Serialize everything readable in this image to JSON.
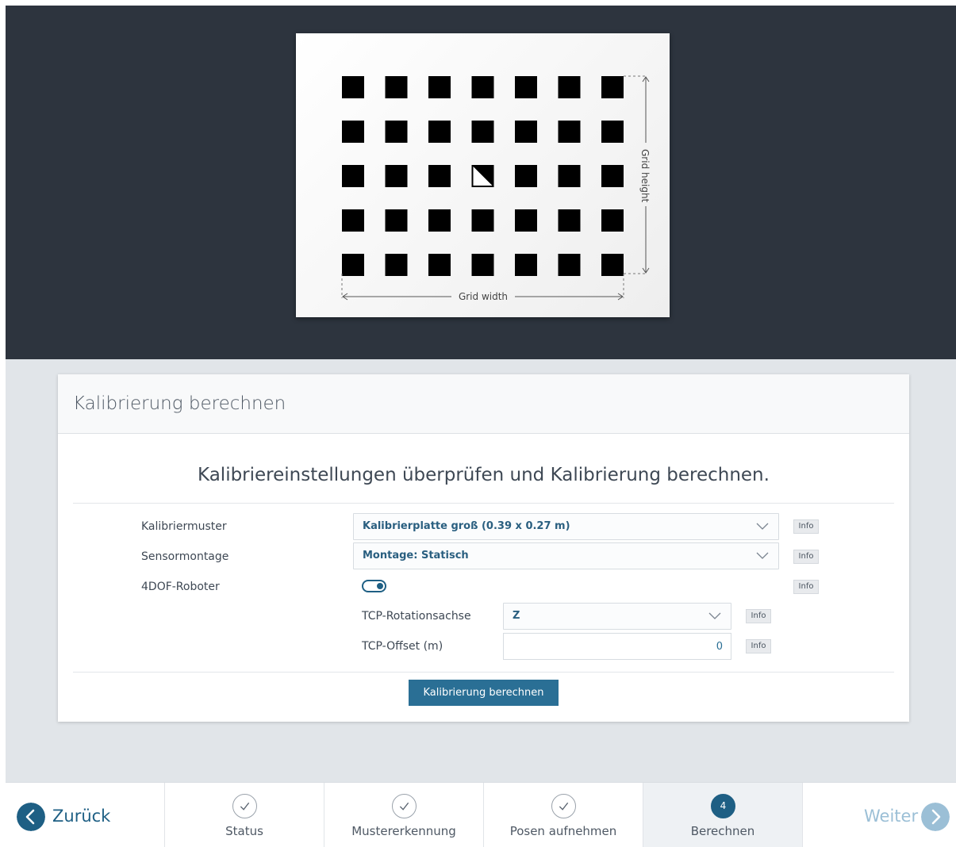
{
  "preview": {
    "grid_width_label": "Grid width",
    "grid_height_label": "Grid height",
    "grid": {
      "columns": 7,
      "rows": 5,
      "marker_column": 4,
      "marker_row": 3
    }
  },
  "card": {
    "title": "Kalibrierung berechnen",
    "subtitle": "Kalibriereinstellungen überprüfen und Kalibrierung berechnen.",
    "rows": {
      "pattern": {
        "label": "Kalibriermuster",
        "value": "Kalibrierplatte groß (0.39 x 0.27 m)",
        "info": "Info"
      },
      "mount": {
        "label": "Sensormontage",
        "value": "Montage: Statisch",
        "info": "Info"
      },
      "robot4dof": {
        "label": "4DOF-Roboter",
        "enabled": true,
        "info": "Info"
      },
      "tcp_axis": {
        "label": "TCP-Rotationsachse",
        "value": "Z",
        "info": "Info"
      },
      "tcp_offset": {
        "label": "TCP-Offset (m)",
        "value": "0",
        "info": "Info"
      }
    },
    "compute_button": "Kalibrierung berechnen"
  },
  "nav": {
    "back_label": "Zurück",
    "next_label": "Weiter",
    "steps": [
      {
        "label": "Status",
        "state": "done"
      },
      {
        "label": "Mustererkennung",
        "state": "done"
      },
      {
        "label": "Posen aufnehmen",
        "state": "done"
      },
      {
        "label": "Berechnen",
        "state": "active",
        "number": "4"
      }
    ]
  },
  "colors": {
    "accent": "#2a6f95",
    "dark_bg": "#2d343e",
    "page_bg": "#e1e5e9"
  }
}
